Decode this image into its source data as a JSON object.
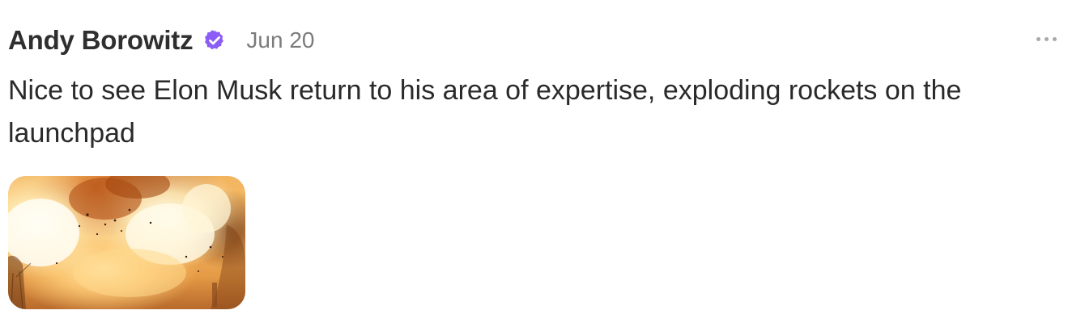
{
  "post": {
    "author_name": "Andy Borowitz",
    "verified_icon": "verified-badge-icon",
    "verified_color": "#8c5cf6",
    "date": "Jun 20",
    "more_icon": "more-horizontal-icon",
    "text": "Nice to see Elon Musk return to his area of expertise, exploding rockets on the launchpad",
    "media": {
      "type": "image",
      "subject": "rocket explosion"
    }
  }
}
